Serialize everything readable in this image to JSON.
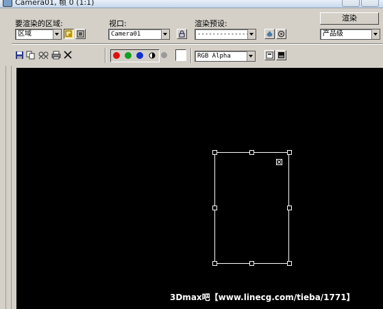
{
  "window": {
    "title": "Camera01, 帧 0 (1:1)"
  },
  "render_panel": {
    "area_label": "要渲染的区域:",
    "area_value": "区域",
    "viewport_label": "视口:",
    "viewport_value": "Camera01",
    "preset_label": "渲染预设:",
    "preset_value": "---------------",
    "render_button": "渲染",
    "quality_value": "产品级"
  },
  "toolbar": {
    "channel_value": "RGB Alpha"
  },
  "colors": {
    "red_channel": "#e01010",
    "green_channel": "#10a020",
    "blue_channel": "#1030d0",
    "viewport_bg": "#000000"
  },
  "icons": [
    "save-icon",
    "copy-icon",
    "clone-icon",
    "print-icon",
    "clear-icon",
    "lock-icon",
    "preset-icon",
    "settings-icon"
  ],
  "watermark": "3Dmax吧【www.linecg.com/tieba/1771】"
}
